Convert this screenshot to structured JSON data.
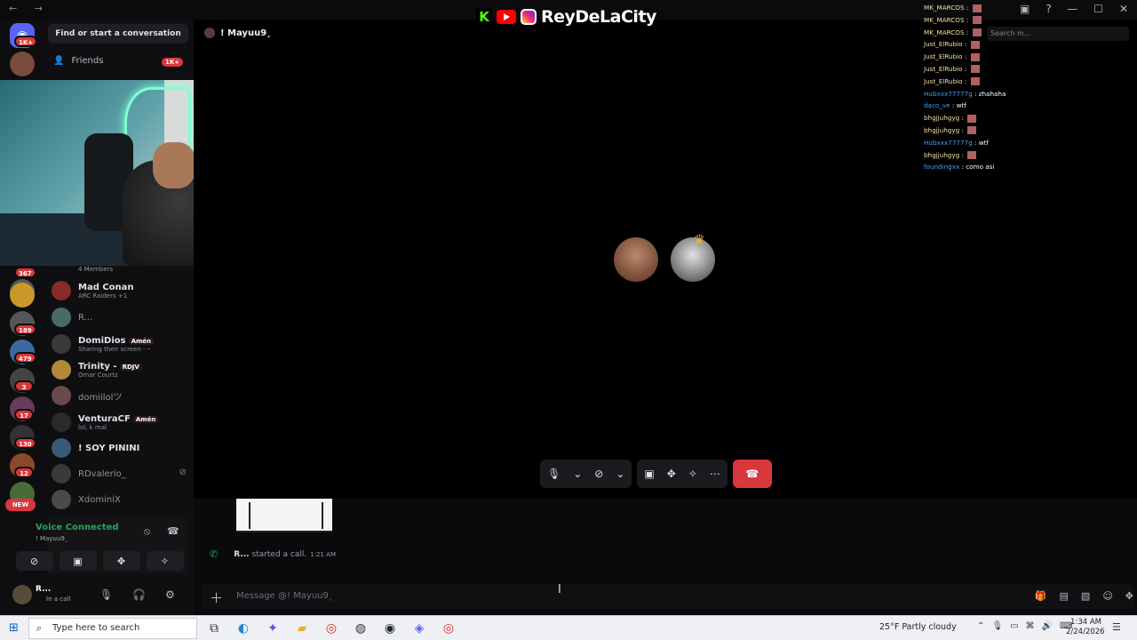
{
  "window": {
    "nav": "← →",
    "controls": [
      "—",
      "☐",
      "✕"
    ],
    "top_icons": [
      "▣",
      "?"
    ]
  },
  "brand": {
    "k": "K",
    "name": "ReyDeLaCity"
  },
  "rail": {
    "home_badge": "1K+",
    "badges": [
      "367",
      "189",
      "479",
      "3",
      "17",
      "130",
      "12"
    ],
    "new_label": "NEW"
  },
  "sidebar": {
    "search": "Find or start a conversation",
    "friends": {
      "label": "Friends",
      "badge": "1K+"
    },
    "members": "4 Members",
    "dms": [
      {
        "name": "Mad Conan",
        "status": "ARC Raiders +1"
      },
      {
        "name": "R...",
        "status": ""
      },
      {
        "name": "DomiDios",
        "tag": "Amén",
        "status": "Sharing their screen · ⁃"
      },
      {
        "name": "Trinity -",
        "tag": "RDJV",
        "status": "Omar Courtz"
      },
      {
        "name": "domiilolツ",
        "status": ""
      },
      {
        "name": "VenturaCF",
        "tag": "Amén",
        "status": "lol, k mal"
      },
      {
        "name": "! SOY PININI",
        "status": ""
      },
      {
        "name": "RDvalerio_",
        "status": ""
      },
      {
        "name": "XdominiX",
        "status": ""
      }
    ],
    "voice": {
      "title": "Voice Connected",
      "subtitle": "! Mayuu9ٕ"
    },
    "user": {
      "name": "R...",
      "status": "In a call"
    }
  },
  "main": {
    "channel": "! Mayuu9ٕ",
    "search_placeholder": "Search m...",
    "call_ended_icon": "✆",
    "chat": {
      "starter": "R...",
      "action": "started a call.",
      "time": "1:21 AM"
    },
    "message_placeholder": "Message @! Mayuu9ٕ"
  },
  "stream_chat": [
    {
      "user": "MK_MARCOS",
      "text": "",
      "blue": false
    },
    {
      "user": "MK_MARCOS",
      "text": "",
      "blue": false
    },
    {
      "user": "MK_MARCOS",
      "text": "",
      "blue": false
    },
    {
      "user": "Just_ElRubio",
      "text": "",
      "blue": false
    },
    {
      "user": "Just_ElRubio",
      "text": "",
      "blue": false
    },
    {
      "user": "Just_ElRubio",
      "text": "",
      "blue": false
    },
    {
      "user": "Just_ElRubio",
      "text": "",
      "blue": false
    },
    {
      "user": "Hubxxx77777g",
      "text": "zhahaha",
      "blue": true
    },
    {
      "user": "daco_ve",
      "text": "wtf",
      "blue": true
    },
    {
      "user": "bhgjjuhgyg",
      "text": "",
      "blue": false
    },
    {
      "user": "bhgjjuhgyg",
      "text": "",
      "blue": false
    },
    {
      "user": "Hubxxx77777g",
      "text": "wtf",
      "blue": true
    },
    {
      "user": "bhgjjuhgyg",
      "text": "",
      "blue": false
    },
    {
      "user": "foundingxx",
      "text": "como asi",
      "blue": true
    }
  ],
  "taskbar": {
    "search_placeholder": "Type here to search",
    "weather": "25°F  Partly cloudy",
    "time": "1:34 AM",
    "date": "2/24/2026"
  },
  "colors": {
    "accent": "#5865f2",
    "end_call": "#da373c",
    "connected": "#23a55a"
  }
}
